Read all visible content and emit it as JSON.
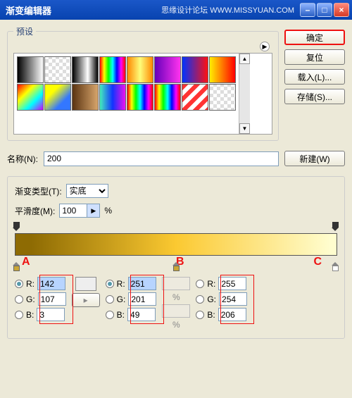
{
  "titlebar": {
    "text": "渐变编辑器",
    "watermark": "思缘设计论坛   WWW.MISSYUAN.COM"
  },
  "buttons": {
    "ok": "确定",
    "reset": "复位",
    "load": "载入(L)...",
    "save": "存储(S)...",
    "new": "新建(W)"
  },
  "presets": {
    "legend": "预设"
  },
  "nameRow": {
    "label": "名称(N):",
    "value": "200"
  },
  "gradset": {
    "typeLabel": "渐变类型(T):",
    "typeValue": "实底",
    "smoothLabel": "平滑度(M):",
    "smoothValue": "100",
    "smoothUnit": "%"
  },
  "letters": {
    "a": "A",
    "b": "B",
    "c": "C"
  },
  "sep": "%",
  "rgbLabels": {
    "r": "R:",
    "g": "G:",
    "b": "B:"
  },
  "stops": {
    "a": {
      "r": "142",
      "g": "107",
      "b": "3"
    },
    "b": {
      "r": "251",
      "g": "201",
      "b": "49"
    },
    "c": {
      "r": "255",
      "g": "254",
      "b": "206"
    }
  },
  "swatches": [
    "linear-gradient(to right,#000,#fff)",
    "repeating-conic-gradient(#fff 0 25%,#ddd 0 50%) 0/10px 10px",
    "linear-gradient(to right,#000,#fff 60%,#000)",
    "linear-gradient(to right,#f00,#ff0,#0f0,#0ff,#00f,#f0f,#f00)",
    "linear-gradient(to right,#f80,#fdfd7a,#f80)",
    "linear-gradient(to right,#60b,#f3e)",
    "linear-gradient(to right,#03f,#f11)",
    "linear-gradient(to right,#fe0,#f00)",
    "linear-gradient(135deg,#f00,#ff0,#0ff,#c0f)",
    "linear-gradient(135deg,#ff0 30%,#37f 70%)",
    "linear-gradient(to right,#5a3311,#d7a56b)",
    "linear-gradient(to right,#4eb,#13f,#e1e)",
    "linear-gradient(to right,#f00,#ff0,#0f0,#0ff,#00f,#f0f,#f00)",
    "linear-gradient(to right,#f00,#ff0,#0f0,#0ff,#00f,#f0f,#f00)",
    "repeating-linear-gradient(135deg,#f33 0 6px,#fff 6px 12px)",
    "repeating-conic-gradient(#fff 0 25%,#ddd 0 50%) 0/10px 10px"
  ]
}
